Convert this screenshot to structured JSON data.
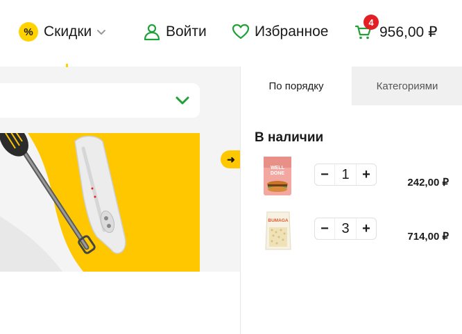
{
  "header": {
    "discounts": {
      "badge": "%",
      "label": "Скидки"
    },
    "login": {
      "label": "Войти"
    },
    "favorites": {
      "label": "Избранное"
    },
    "cart": {
      "count": "4",
      "total": "956,00 ₽"
    }
  },
  "colors": {
    "brand_yellow": "#ffc700",
    "accent_green": "#21a038",
    "badge_red": "#e31e24"
  },
  "banner": {
    "arrow": "➜"
  },
  "cart_panel": {
    "tabs": [
      {
        "label": "По порядку",
        "active": true
      },
      {
        "label": "Категориями",
        "active": false
      }
    ],
    "section_title": "В наличии",
    "items": [
      {
        "name_on_pack": "WELL DONE",
        "minus": "−",
        "qty": "1",
        "plus": "+",
        "price": "242,00 ₽"
      },
      {
        "name_on_pack": "BUMAGA",
        "minus": "−",
        "qty": "3",
        "plus": "+",
        "price": "714,00 ₽"
      }
    ]
  }
}
